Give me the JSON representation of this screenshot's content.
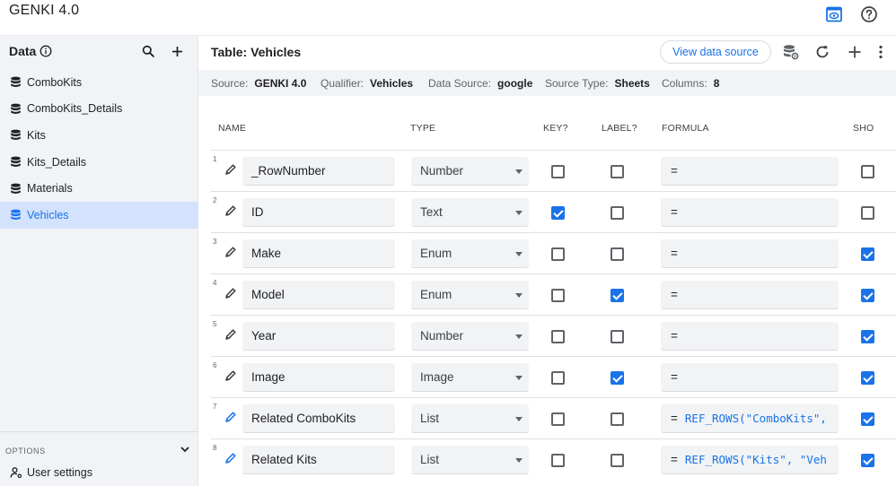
{
  "app": {
    "title": "GENKI 4.0"
  },
  "topbar": {
    "preview_icon": "preview-icon",
    "help_icon": "help-icon"
  },
  "sidebar": {
    "header": "Data",
    "items": [
      {
        "label": "ComboKits",
        "active": false
      },
      {
        "label": "ComboKits_Details",
        "active": false
      },
      {
        "label": "Kits",
        "active": false
      },
      {
        "label": "Kits_Details",
        "active": false
      },
      {
        "label": "Materials",
        "active": false
      },
      {
        "label": "Vehicles",
        "active": true
      }
    ],
    "options_label": "OPTIONS",
    "user_settings_label": "User settings"
  },
  "main": {
    "title": "Table: Vehicles",
    "view_data_source_label": "View data source",
    "info": {
      "source_label": "Source:",
      "source_value": "GENKI 4.0",
      "qualifier_label": "Qualifier:",
      "qualifier_value": "Vehicles",
      "datasource_label": "Data Source:",
      "datasource_value": "google",
      "sourcetype_label": "Source Type:",
      "sourcetype_value": "Sheets",
      "columns_label": "Columns:",
      "columns_value": "8"
    },
    "columns": {
      "name": "NAME",
      "type": "TYPE",
      "key": "KEY?",
      "label": "LABEL?",
      "formula": "FORMULA",
      "show": "SHO"
    },
    "rows": [
      {
        "num": "1",
        "name": "_RowNumber",
        "type": "Number",
        "key": false,
        "label": false,
        "formula_prefix": "=",
        "formula_code": "",
        "show": false,
        "pen_color": "#3c4043"
      },
      {
        "num": "2",
        "name": "ID",
        "type": "Text",
        "key": true,
        "label": false,
        "formula_prefix": "=",
        "formula_code": "",
        "show": false,
        "pen_color": "#3c4043"
      },
      {
        "num": "3",
        "name": "Make",
        "type": "Enum",
        "key": false,
        "label": false,
        "formula_prefix": "=",
        "formula_code": "",
        "show": true,
        "pen_color": "#3c4043"
      },
      {
        "num": "4",
        "name": "Model",
        "type": "Enum",
        "key": false,
        "label": true,
        "formula_prefix": "=",
        "formula_code": "",
        "show": true,
        "pen_color": "#3c4043"
      },
      {
        "num": "5",
        "name": "Year",
        "type": "Number",
        "key": false,
        "label": false,
        "formula_prefix": "=",
        "formula_code": "",
        "show": true,
        "pen_color": "#3c4043"
      },
      {
        "num": "6",
        "name": "Image",
        "type": "Image",
        "key": false,
        "label": true,
        "formula_prefix": "=",
        "formula_code": "",
        "show": true,
        "pen_color": "#3c4043"
      },
      {
        "num": "7",
        "name": "Related ComboKits",
        "type": "List",
        "key": false,
        "label": false,
        "formula_prefix": "=",
        "formula_code": "REF_ROWS(\"ComboKits\",",
        "show": true,
        "pen_color": "#1a73e8"
      },
      {
        "num": "8",
        "name": "Related Kits",
        "type": "List",
        "key": false,
        "label": false,
        "formula_prefix": "=",
        "formula_code": "REF_ROWS(\"Kits\", \"Veh",
        "show": true,
        "pen_color": "#1a73e8"
      }
    ]
  },
  "colors": {
    "accent": "#1a73e8",
    "sidebar_bg": "#f1f3f6",
    "active_bg": "#d3e3fd"
  }
}
